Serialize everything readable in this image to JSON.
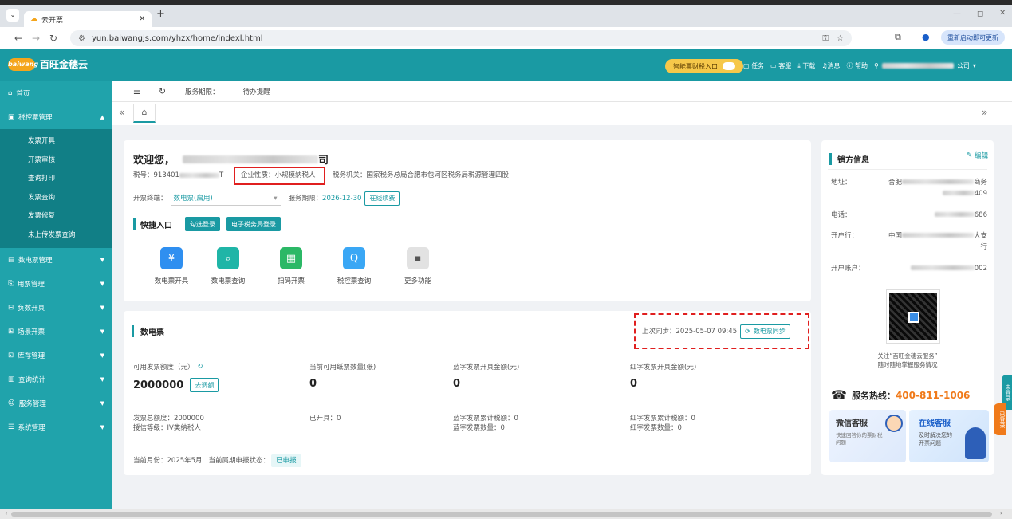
{
  "browser": {
    "tab_title": "云开票",
    "url": "yun.baiwangjs.com/yhzx/home/indexl.html",
    "update_label": "重新启动即可更新"
  },
  "header": {
    "logo_mark": "baiwang",
    "brand": "百旺金穗云",
    "smart_button": "智能票财税入口",
    "menu": [
      "任务",
      "客服",
      "下载",
      "消息",
      "帮助"
    ],
    "user_suffix": "公司"
  },
  "sidebar": {
    "items": [
      {
        "label": "首页",
        "icon": "home-icon"
      },
      {
        "label": "税控票管理",
        "icon": "invoice-icon",
        "expanded": true
      },
      {
        "label": "数电票管理",
        "icon": "digital-invoice-icon"
      },
      {
        "label": "用票管理",
        "icon": "ticket-icon"
      },
      {
        "label": "负数开具",
        "icon": "minus-doc-icon"
      },
      {
        "label": "场景开票",
        "icon": "scene-icon"
      },
      {
        "label": "库存管理",
        "icon": "stock-icon"
      },
      {
        "label": "查询统计",
        "icon": "chart-icon"
      },
      {
        "label": "服务管理",
        "icon": "service-icon"
      },
      {
        "label": "系统管理",
        "icon": "settings-icon"
      }
    ],
    "subitems": [
      "发票开具",
      "开票审核",
      "查询打印",
      "发票查询",
      "发票修复",
      "未上传发票查询"
    ]
  },
  "topbar": {
    "service_label": "服务期限：",
    "reminder": "待办提醒"
  },
  "welcome": {
    "greeting": "欢迎您，",
    "company_tail": "司",
    "tax_no_label": "税号：",
    "tax_no_prefix": "913401",
    "tax_no_suffix": "T",
    "nature": "企业性质：小规模纳税人",
    "tax_office": "税务机关：国家税务总局合肥市包河区税务局税源管理四股",
    "terminal_label": "开票终端：",
    "terminal_value": "数电票(启用)",
    "service_label": "服务期限：",
    "service_date": "2026-12-30",
    "renew": "在线续费",
    "quick_title": "快捷入口",
    "btn_select_login": "勾选登录",
    "btn_etax_login": "电子税务局登录",
    "quick_items": [
      {
        "label": "数电票开具",
        "icon": "invoice-issue-icon",
        "color": "#2f8ff0",
        "glyph": "¥"
      },
      {
        "label": "数电票查询",
        "icon": "invoice-search-icon",
        "color": "#1fb5a7",
        "glyph": "⌕"
      },
      {
        "label": "扫码开票",
        "icon": "qr-code-icon",
        "color": "#2bb866",
        "glyph": "▦"
      },
      {
        "label": "税控票查询",
        "icon": "tax-search-icon",
        "color": "#3aa7f5",
        "glyph": "Q"
      },
      {
        "label": "更多功能",
        "icon": "more-icon",
        "color": "#dcdcdc",
        "glyph": "▪"
      }
    ]
  },
  "invoice": {
    "title": "数电票",
    "last_sync": "上次同步：2025-05-07 09:45",
    "sync_btn": "数电票同步",
    "stats": [
      {
        "label": "可用发票额度（元）",
        "value": "2000000",
        "extra_btn": "去调额"
      },
      {
        "label": "当前可用纸票数量(张)",
        "value": "0"
      },
      {
        "label": "蓝字发票开具金额(元)",
        "value": "0"
      },
      {
        "label": "红字发票开具金额(元)",
        "value": "0"
      }
    ],
    "details": [
      [
        "发票总额度：2000000",
        "授信等级：IV类纳税人"
      ],
      [
        "已开具：0"
      ],
      [
        "蓝字发票累计税额：0",
        "蓝字发票数量：0"
      ],
      [
        "红字发票累计税额：0",
        "红字发票数量：0"
      ]
    ],
    "month": "当前月份：2025年5月",
    "declare_label": "当前属期申报状态：",
    "declare_status": "已申报"
  },
  "seller": {
    "title": "销方信息",
    "edit": "编辑",
    "rows": [
      {
        "label": "地址：",
        "prefix": "合肥",
        "line1_end": "商务",
        "line2_end": "409"
      },
      {
        "label": "电话：",
        "prefix": "",
        "line1_end": "686",
        "line2_end": ""
      },
      {
        "label": "开户行：",
        "prefix": "中国",
        "line1_end": "大支",
        "line2_end": "行"
      },
      {
        "label": "开户账户：",
        "prefix": "",
        "line1_end": "002",
        "line2_end": ""
      }
    ],
    "qr_caption1": "关注“百旺金穗云服务”",
    "qr_caption2": "随时随地掌握服务情况",
    "hotline_label": "服务热线：",
    "hotline": "400-811-1006",
    "wechat_title": "微信客服",
    "wechat_desc1": "快速回答你的票财税",
    "wechat_desc2": "问题",
    "online_title": "在线客服",
    "online_desc1": "及时解决您的",
    "online_desc2": "开票问题"
  },
  "side_tabs": [
    "未登录",
    "已登录"
  ],
  "colors": {
    "primary": "#1a9aa3",
    "sidebar": "#20a3ab",
    "accent": "#f6c84a",
    "hotline": "#f07a1a",
    "highlight": "#e01f1f"
  }
}
